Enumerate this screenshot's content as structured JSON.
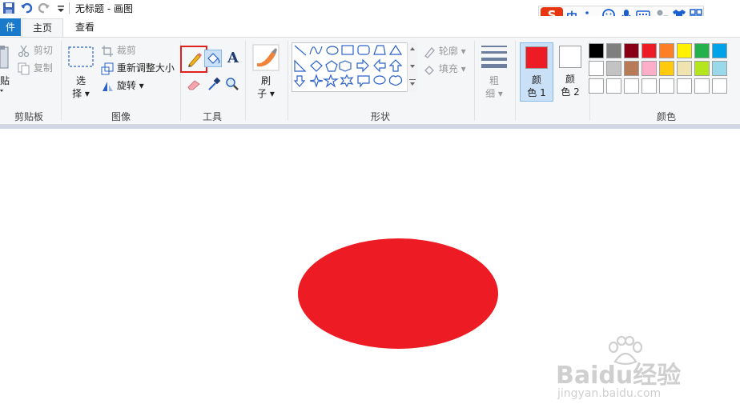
{
  "window": {
    "title": "无标题 - 画图"
  },
  "tabs": {
    "file": "件",
    "home": "主页",
    "view": "查看"
  },
  "clipboard": {
    "paste": "贴",
    "cut": "剪切",
    "copy": "复制",
    "label": "剪贴板"
  },
  "image": {
    "select_top": "选",
    "select_bottom": "择",
    "crop": "裁剪",
    "resize": "重新调整大小",
    "rotate": "旋转",
    "label": "图像"
  },
  "tools": {
    "label": "工具",
    "text_glyph": "A"
  },
  "brushes": {
    "line1": "刷",
    "line2": "子"
  },
  "shapes": {
    "outline": "轮廓",
    "fill": "填充",
    "label": "形状"
  },
  "size": {
    "line1": "粗",
    "line2": "细"
  },
  "color1": {
    "line1": "颜",
    "line2": "色 1",
    "value": "#ed1c24"
  },
  "color2": {
    "line1": "颜",
    "line2": "色 2",
    "value": "#ffffff"
  },
  "colors": {
    "label": "颜色",
    "row1": [
      "#000000",
      "#7f7f7f",
      "#880015",
      "#ed1c24",
      "#ff7f27",
      "#fff200",
      "#22b14c",
      "#00a2e8",
      "#3f48cc"
    ],
    "row2": [
      "#ffffff",
      "#c3c3c3",
      "#b97a57",
      "#ffaec9",
      "#ffc90e",
      "#efe4b0",
      "#b5e61d",
      "#99d9ea",
      "#7092be"
    ],
    "row3": [
      "#ffffff",
      "#ffffff",
      "#ffffff",
      "#ffffff",
      "#ffffff",
      "#ffffff",
      "#ffffff",
      "#ffffff",
      "#ffffff"
    ]
  },
  "ime": {
    "logo": "S",
    "mode": "中"
  },
  "canvas": {
    "ellipse_color": "#ed1c24"
  },
  "watermark": {
    "brand": "Baidu经验",
    "url": "jingyan.baidu.com"
  }
}
